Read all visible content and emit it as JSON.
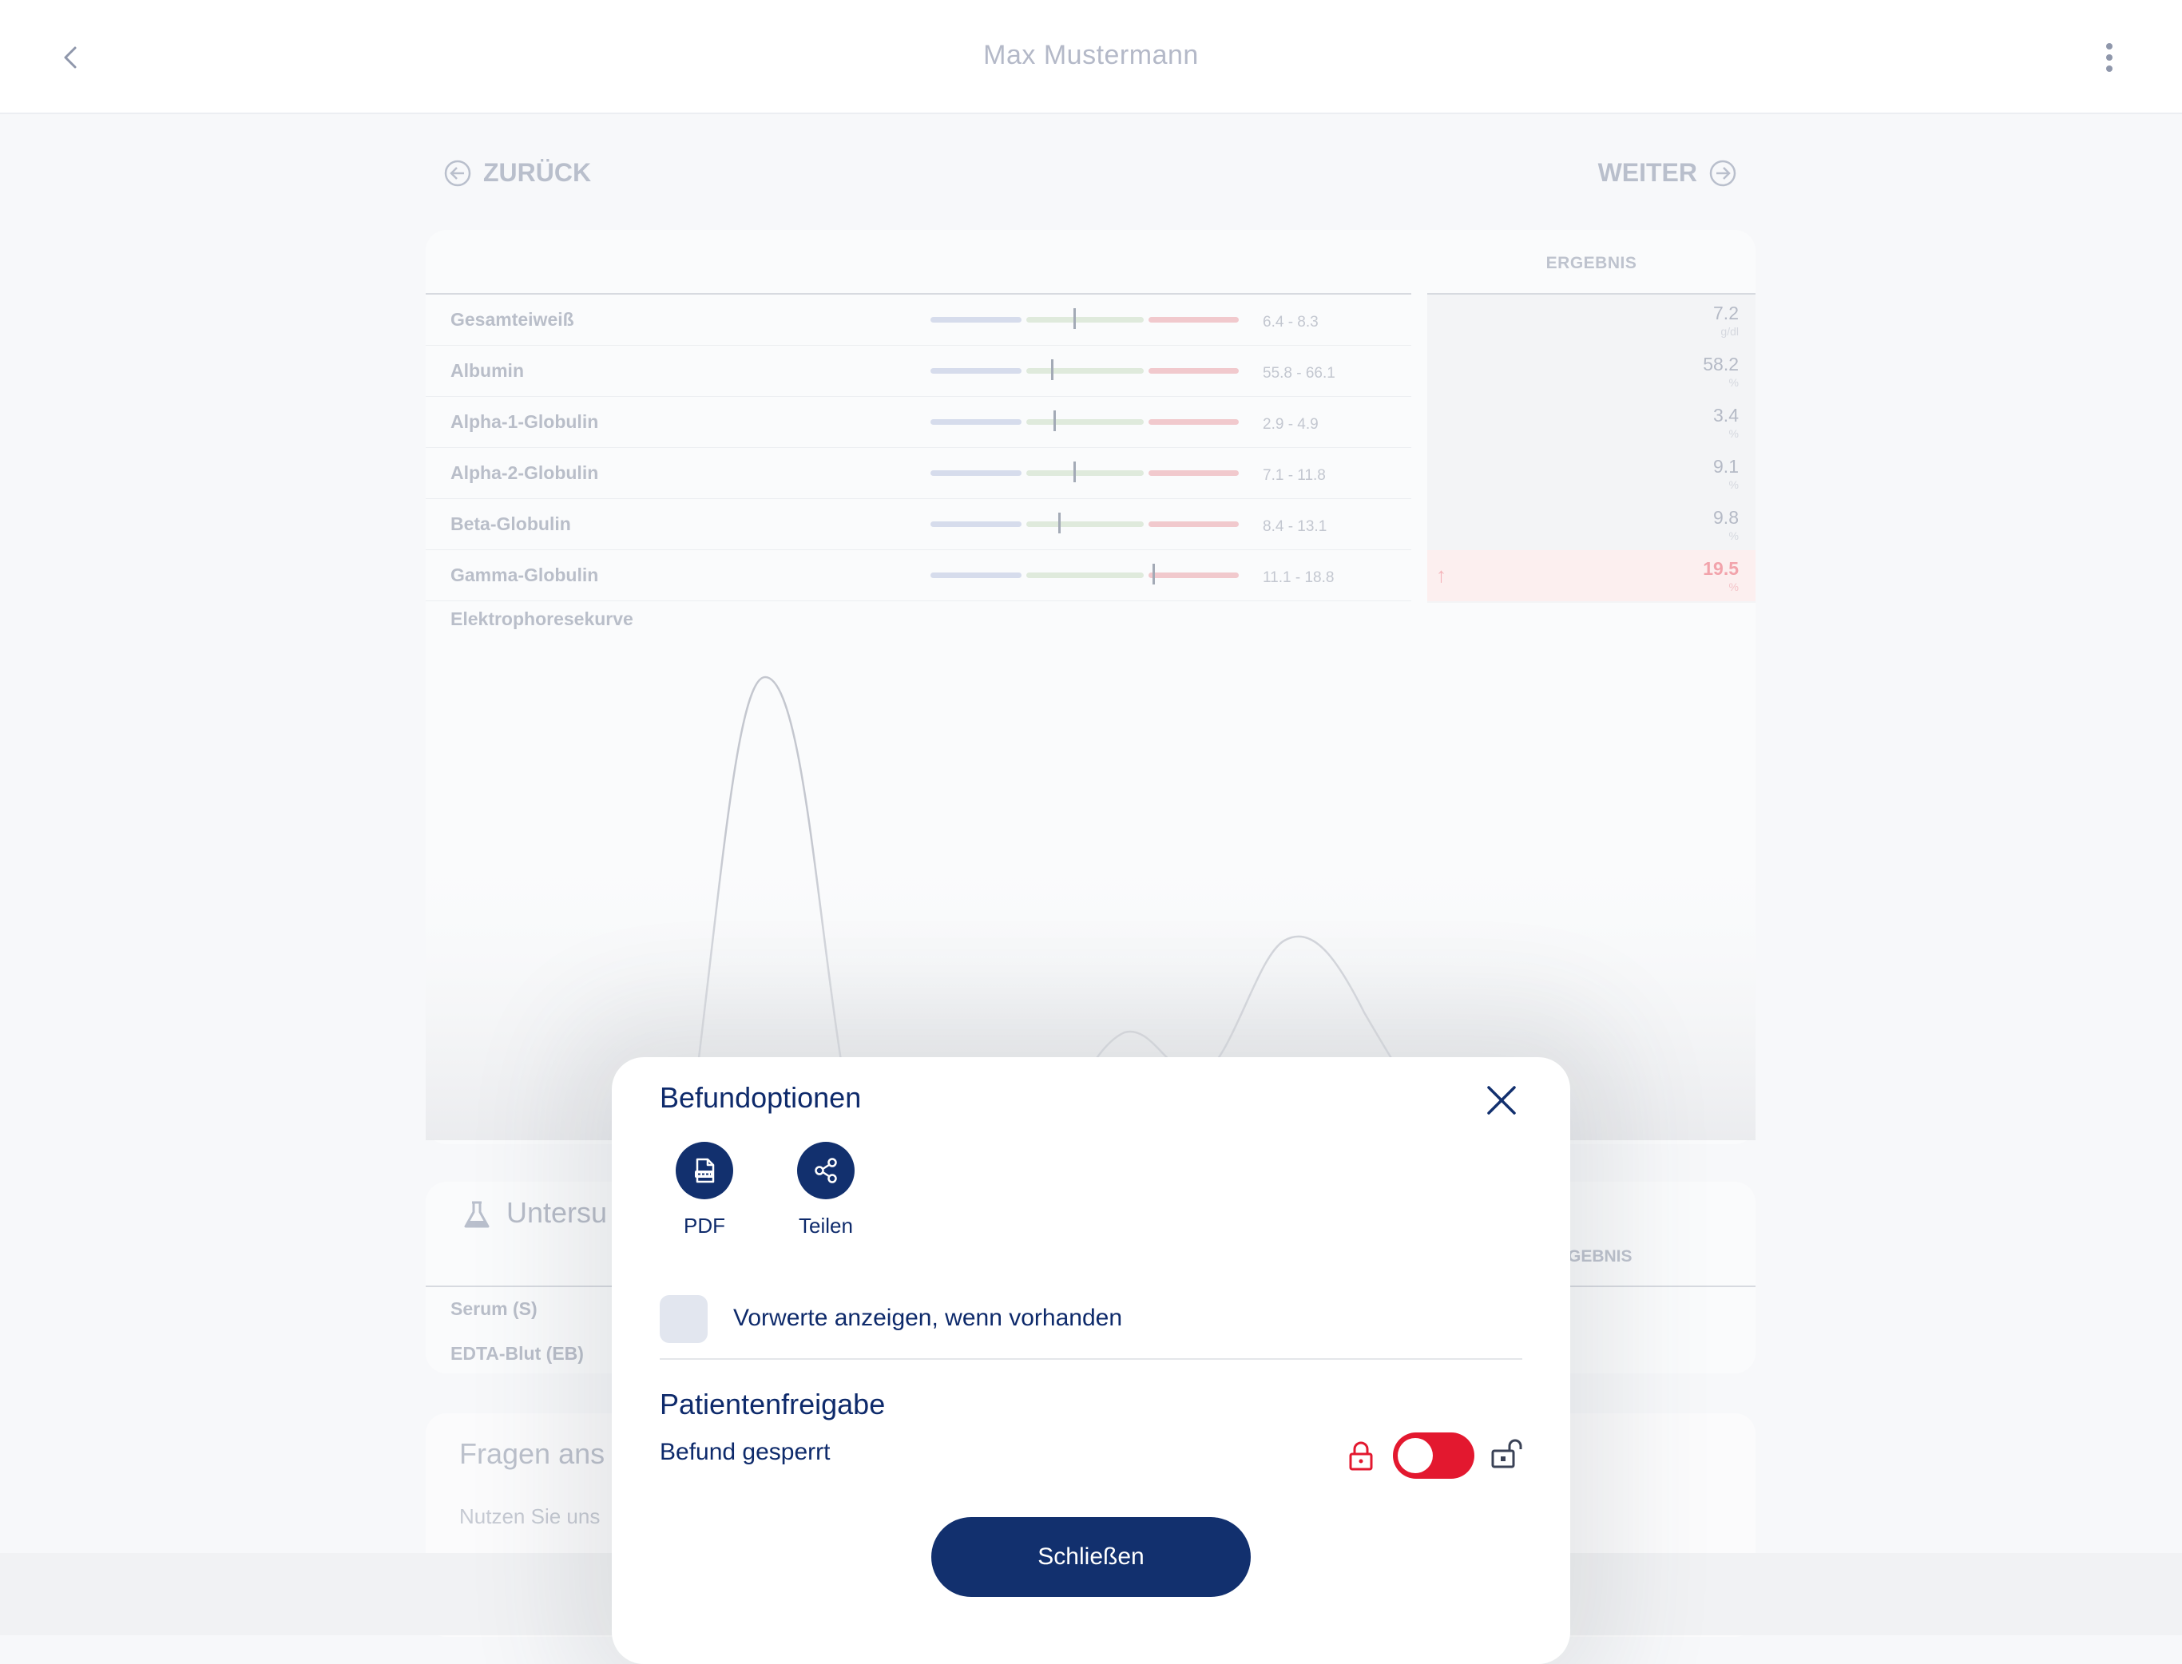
{
  "header": {
    "title": "Max Mustermann",
    "back_icon": "chevron-left-icon",
    "menu_icon": "more-vertical-icon"
  },
  "nav": {
    "prev_label": "ZURÜCK",
    "next_label": "WEITER"
  },
  "results": {
    "column_header": "ERGEBNIS",
    "rows": [
      {
        "name": "Gesamteiweiß",
        "range": "6.4 - 8.3",
        "value": "7.2",
        "unit": "g/dl",
        "alert": false
      },
      {
        "name": "Albumin",
        "range": "55.8 - 66.1",
        "value": "58.2",
        "unit": "%",
        "alert": false
      },
      {
        "name": "Alpha-1-Globulin",
        "range": "2.9 - 4.9",
        "value": "3.4",
        "unit": "%",
        "alert": false
      },
      {
        "name": "Alpha-2-Globulin",
        "range": "7.1 - 11.8",
        "value": "9.1",
        "unit": "%",
        "alert": false
      },
      {
        "name": "Beta-Globulin",
        "range": "8.4 - 13.1",
        "value": "9.8",
        "unit": "%",
        "alert": false
      },
      {
        "name": "Gamma-Globulin",
        "range": "11.1 - 18.8",
        "value": "19.5",
        "unit": "%",
        "alert": true
      }
    ],
    "curve_label": "Elektrophoresekurve"
  },
  "samples": {
    "title": "Untersu",
    "column_header": "GEBNIS",
    "items": [
      "Serum (S)",
      "EDTA-Blut (EB)"
    ]
  },
  "questions": {
    "title": "Fragen ans",
    "subtitle": "Nutzen Sie uns"
  },
  "modal": {
    "title": "Befundoptionen",
    "actions": [
      {
        "label": "PDF",
        "icon": "pdf-file-icon"
      },
      {
        "label": "Teilen",
        "icon": "share-icon"
      }
    ],
    "checkbox_label": "Vorwerte anzeigen, wenn vorhanden",
    "checkbox_checked": false,
    "section_title": "Patientenfreigabe",
    "status_label": "Befund gesperrt",
    "toggle_on": false,
    "toggle_color": "#e3182f",
    "close_button": "Schließen"
  },
  "colors": {
    "primary": "#12306e",
    "alert": "#e3182f"
  }
}
